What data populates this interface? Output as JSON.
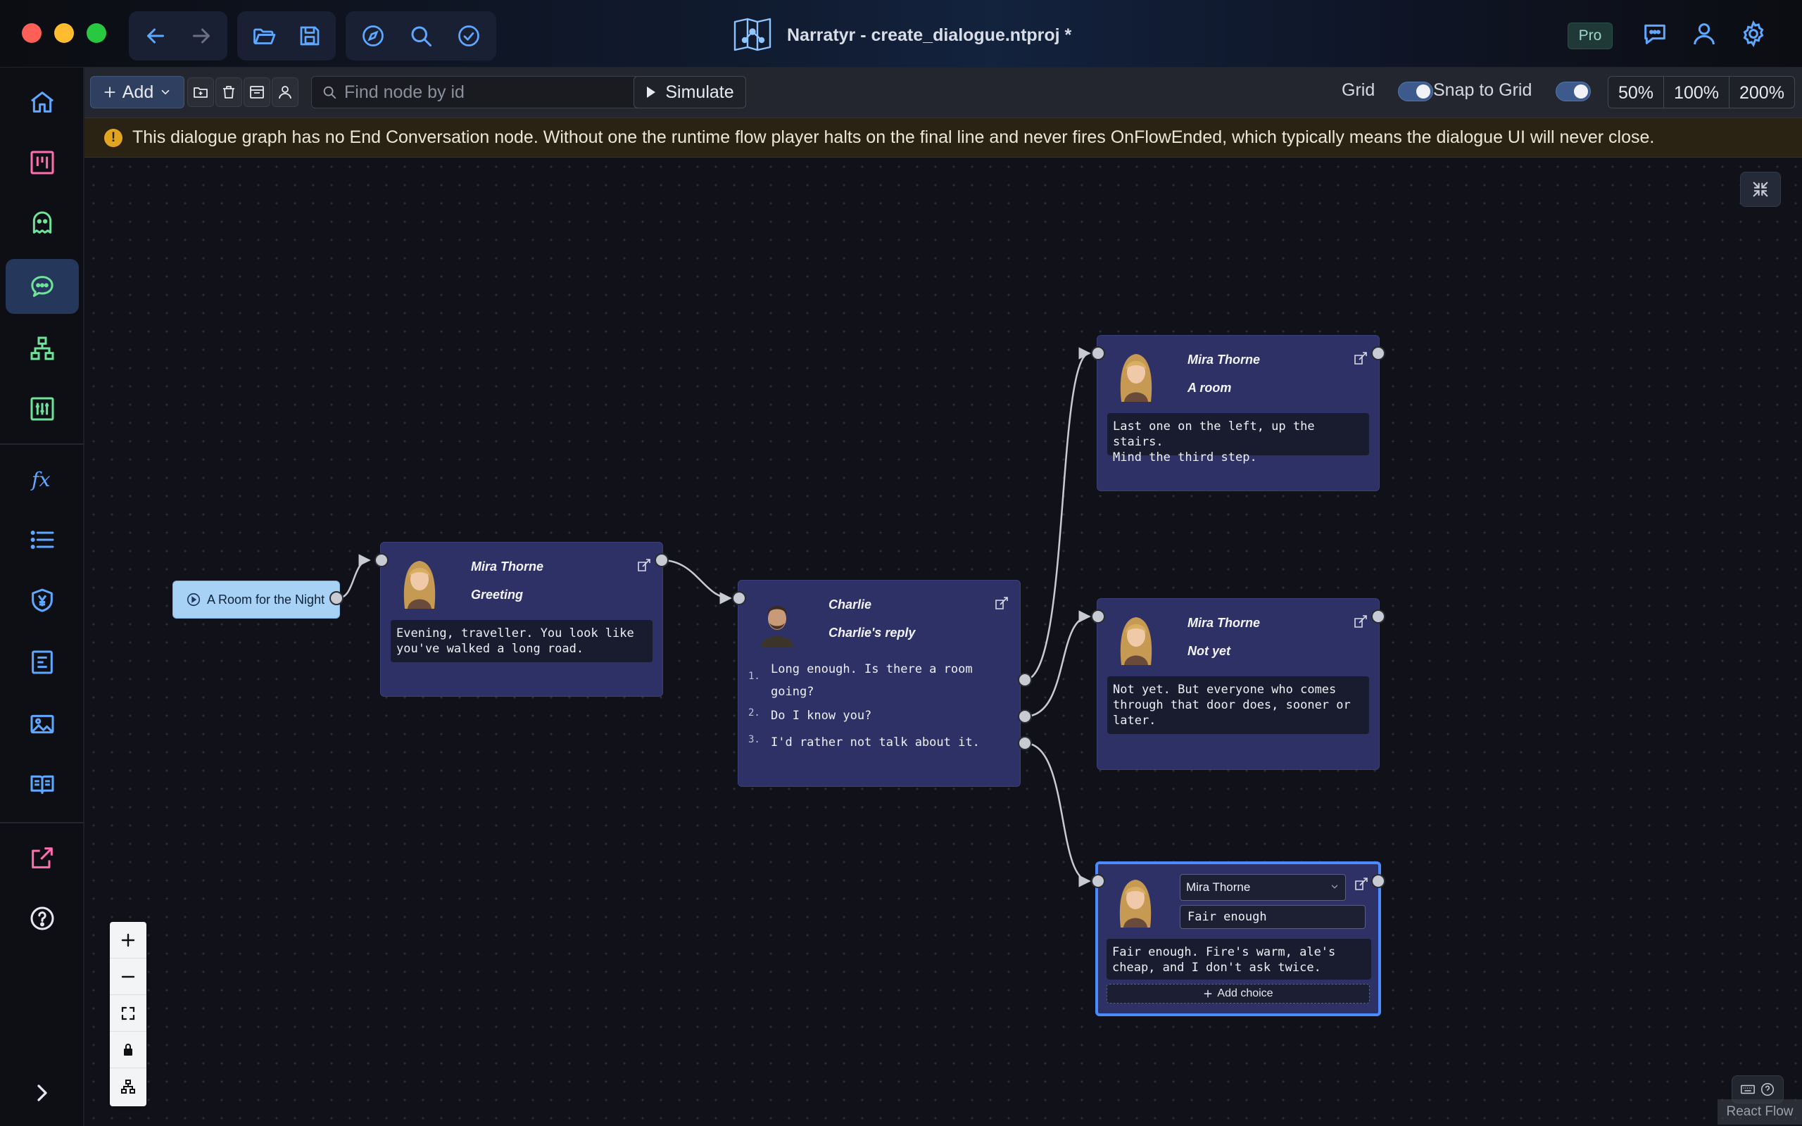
{
  "window": {
    "title": "Narratyr - create_dialogue.ntproj *",
    "badge": "Pro"
  },
  "toolbar": {
    "add_label": "Add",
    "search_placeholder": "Find node by id",
    "simulate_label": "Simulate",
    "grid_label": "Grid",
    "snap_label": "Snap to Grid",
    "grid_on": true,
    "snap_on": true,
    "zoom_levels": [
      "50%",
      "100%",
      "200%"
    ]
  },
  "warning": {
    "text": "This dialogue graph has no End Conversation node. Without one the runtime flow player halts on the final line and never fires OnFlowEnded, which typically means the dialogue UI will never close."
  },
  "graph": {
    "start": {
      "label": "A Room for the Night"
    },
    "nodes": [
      {
        "id": "greeting",
        "speaker": "Mira Thorne",
        "title": "Greeting",
        "text": "Evening, traveller. You look like\nyou've walked a long road."
      },
      {
        "id": "charlie_reply",
        "speaker": "Charlie",
        "title": "Charlie's reply",
        "choices": [
          {
            "num": "1.",
            "text": "Long enough. Is there a room\ngoing?"
          },
          {
            "num": "2.",
            "text": "Do I know you?"
          },
          {
            "num": "3.",
            "text": "I'd rather not talk about it."
          }
        ]
      },
      {
        "id": "a_room",
        "speaker": "Mira Thorne",
        "title": "A room",
        "text": "Last one on the left, up the stairs.\nMind the third step."
      },
      {
        "id": "not_yet",
        "speaker": "Mira Thorne",
        "title": "Not yet",
        "text": "Not yet. But everyone who comes\nthrough that door does, sooner or\nlater."
      },
      {
        "id": "fair_enough",
        "speaker": "Mira Thorne",
        "title": "Fair enough",
        "text": "Fair enough. Fire's warm, ale's\ncheap, and I don't ask twice.",
        "add_choice_label": "Add choice"
      }
    ]
  },
  "attribution": "React Flow",
  "colors": {
    "accent": "#4a8cff",
    "node_bg": "#2e3166",
    "start_node": "#a7d2f5",
    "warning_icon": "#e2a51f",
    "sidebar_icon_blue": "#5fa8ff",
    "sidebar_icon_green": "#6fe39a"
  }
}
